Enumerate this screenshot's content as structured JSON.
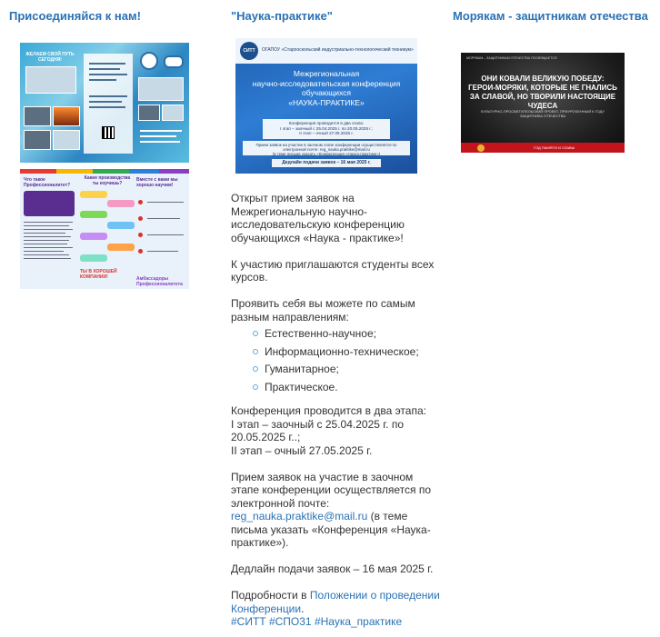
{
  "columns": {
    "left": {
      "title": "Присоединяйся к нам!",
      "brochure1": {
        "caption": "ЖЕЛАЕМ СВОЙ ПУТЬ СЕГОДНЯ!",
        "badge_left": "СИТТ",
        "badge_right": "КПФО"
      },
      "brochure2": {
        "heading_left": "Что такое Профессионалитет?",
        "heading_mid": "Какие производства ты изучишь?",
        "heading_right": "Вместе с вами мы хорошо научим!",
        "bottom_left": "ТЫ В ХОРОШЕЙ КОМПАНИИ!",
        "bottom_right": "Амбассадоры Профессионалитета"
      }
    },
    "middle": {
      "title": "\"Наука-практике\"",
      "poster": {
        "logo": "СИТТ",
        "org": "ОГАПОУ «Старооскольский индустриально-технологический техникум»",
        "title_line1": "Межрегиональная",
        "title_line2": "научно-исследовательская конференция",
        "title_line3": "обучающихся",
        "title_line4": "«НАУКА-ПРАКТИКЕ»",
        "box_line1": "Конференция проводится в два этапа:",
        "box_line2": "I этап – заочный с 25.04.2025 г. по 20.05.2025 г.;",
        "box_line3": "II этап – очный 27.05.2025 г.",
        "note_line1": "Прием заявок на участие в заочном этапе конференции осуществляется по",
        "note_line2": "электронной почте: reg_nauka.praktike@mail.ru",
        "note_line3": "(в теме письма указать «Конференция «Наука-практике»)",
        "deadline": "Дедлайн подачи заявок – 16 мая 2025 г."
      },
      "article": {
        "intro": "Открыт прием заявок на Межрегиональную научно-исследовательскую конференцию обучающихся «Наука - практике»!",
        "invited": "К участию приглашаются студенты всех курсов.",
        "directions_intro": "Проявить себя вы можете по самым разным направлениям:",
        "directions": [
          "Естественно-научное;",
          "Информационно-техническое;",
          "Гуманитарное;",
          "Практическое."
        ],
        "stages_line1": "Конференция проводится в два этапа:",
        "stages_line2": "I этап – заочный с 25.04.2025 г. по 20.05.2025 г..;",
        "stages_line3": "II этап – очный 27.05.2025 г.",
        "applications_text": "Прием заявок на участие в заочном этапе конференции осуществляется по электронной почте:",
        "email": "reg_nauka.praktike@mail.ru",
        "applications_tail": " (в теме письма указать «Конференция «Наука-практике»).",
        "deadline": "Дедлайн подачи заявок – 16 мая 2025 г.",
        "details_prefix": "Подробности в ",
        "details_link": "Положении о проведении Конференции",
        "details_suffix": ".",
        "hashtags": "#СИТТ #СПО31 #Наука_практике"
      }
    },
    "right": {
      "title": "Морякам - защитникам отечества",
      "poster": {
        "small_top": "МОРЯКАМ – ЗАЩИТНИКАМ ОТЕЧЕСТВА ПОСВЯЩАЕТСЯ",
        "headline_line1": "ОНИ КОВАЛИ ВЕЛИКУЮ ПОБЕДУ:",
        "headline_line2": "ГЕРОИ-МОРЯКИ, КОТОРЫЕ НЕ ГНАЛИСЬ",
        "headline_line3": "ЗА СЛАВОЙ, НО ТВОРИЛИ НАСТОЯЩИЕ ЧУДЕСА",
        "sub": "КУЛЬТУРНО-ПРОСВЕТИТЕЛЬСКИЙ ПРОЕКТ, ПРИУРОЧЕННЫЙ К ГОДУ ЗАЩИТНИКА ОТЕЧЕСТВА",
        "bar_text": "ГОД ПАМЯТИ И СЛАВЫ"
      }
    }
  },
  "colors": {
    "link": "#2a72b5",
    "text": "#333333",
    "bullet": "#5fa7d6"
  }
}
